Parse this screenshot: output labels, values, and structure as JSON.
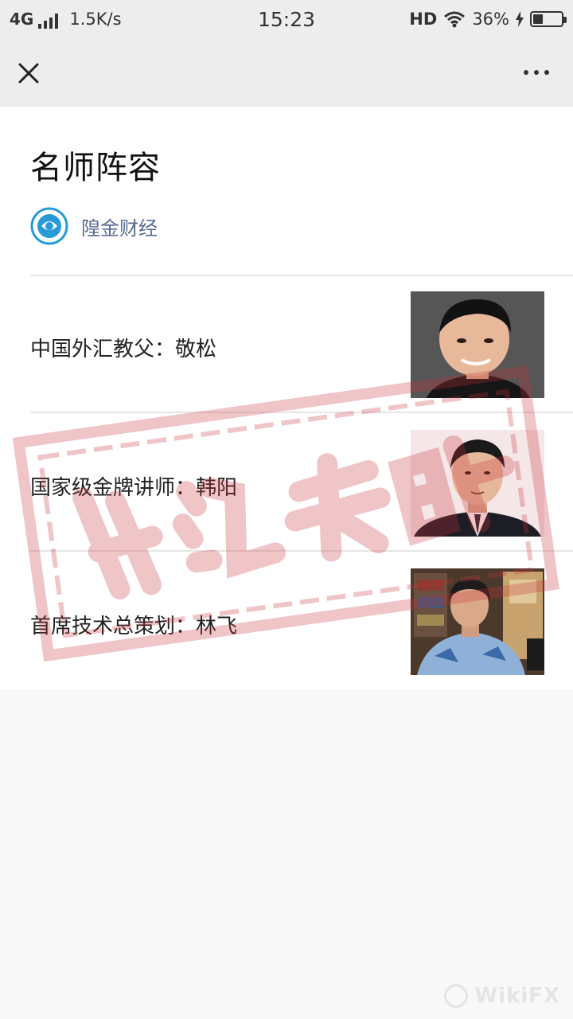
{
  "status_bar": {
    "network": "4G",
    "speed": "1.5K/s",
    "time": "15:23",
    "hd": "HD",
    "battery": "36%",
    "battery_level": 0.36
  },
  "nav": {
    "close_icon": "close-icon",
    "more_icon": "more-dots-icon"
  },
  "article": {
    "title": "名师阵容",
    "author": "隍金财经",
    "rows": [
      {
        "label": "中国外汇教父：敬松"
      },
      {
        "label": "国家级金牌讲师：韩阳"
      },
      {
        "label": "首席技术总策划：林飞"
      }
    ]
  },
  "colors": {
    "accent_link": "#576b95",
    "stamp": "#c9323a",
    "nav_bg": "#ededed"
  },
  "watermark": {
    "stamp_text": "外汇天眼",
    "corner_text": "WikiFX"
  }
}
